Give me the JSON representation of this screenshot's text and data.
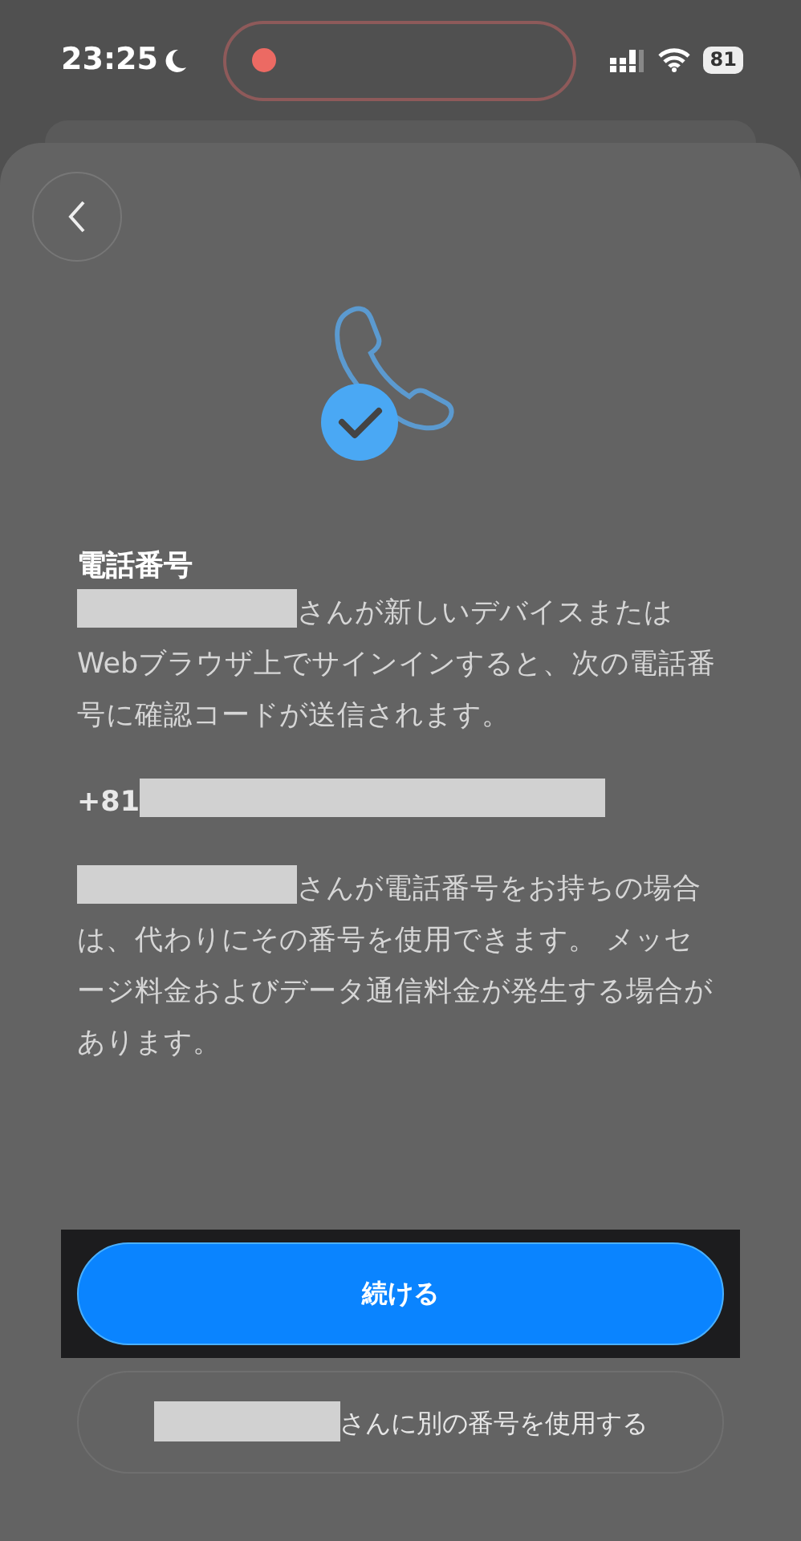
{
  "status_bar": {
    "time": "23:25",
    "battery": "81",
    "recording": true
  },
  "title": "電話番号",
  "paragraphs": [
    {
      "text": "さんが新しいデバイスまたはWebブラウザ上でサインインすると、次の電話番号に確認コードが送信されます。",
      "redacted": true
    },
    {
      "text": "+81",
      "redacted": true,
      "kind": "phone"
    },
    {
      "text": "さんが電話番号をお持ちの場合は、代わりにその番号を使用できます。 メッセージ料金およびデータ通信料金が発生する場合があります。",
      "redacted": true
    }
  ],
  "buttons": [
    {
      "label": "続ける",
      "kind": "primary",
      "redacted": false
    },
    {
      "label": "さんに別の番号を使用する",
      "kind": "secondary",
      "redacted": true
    }
  ]
}
